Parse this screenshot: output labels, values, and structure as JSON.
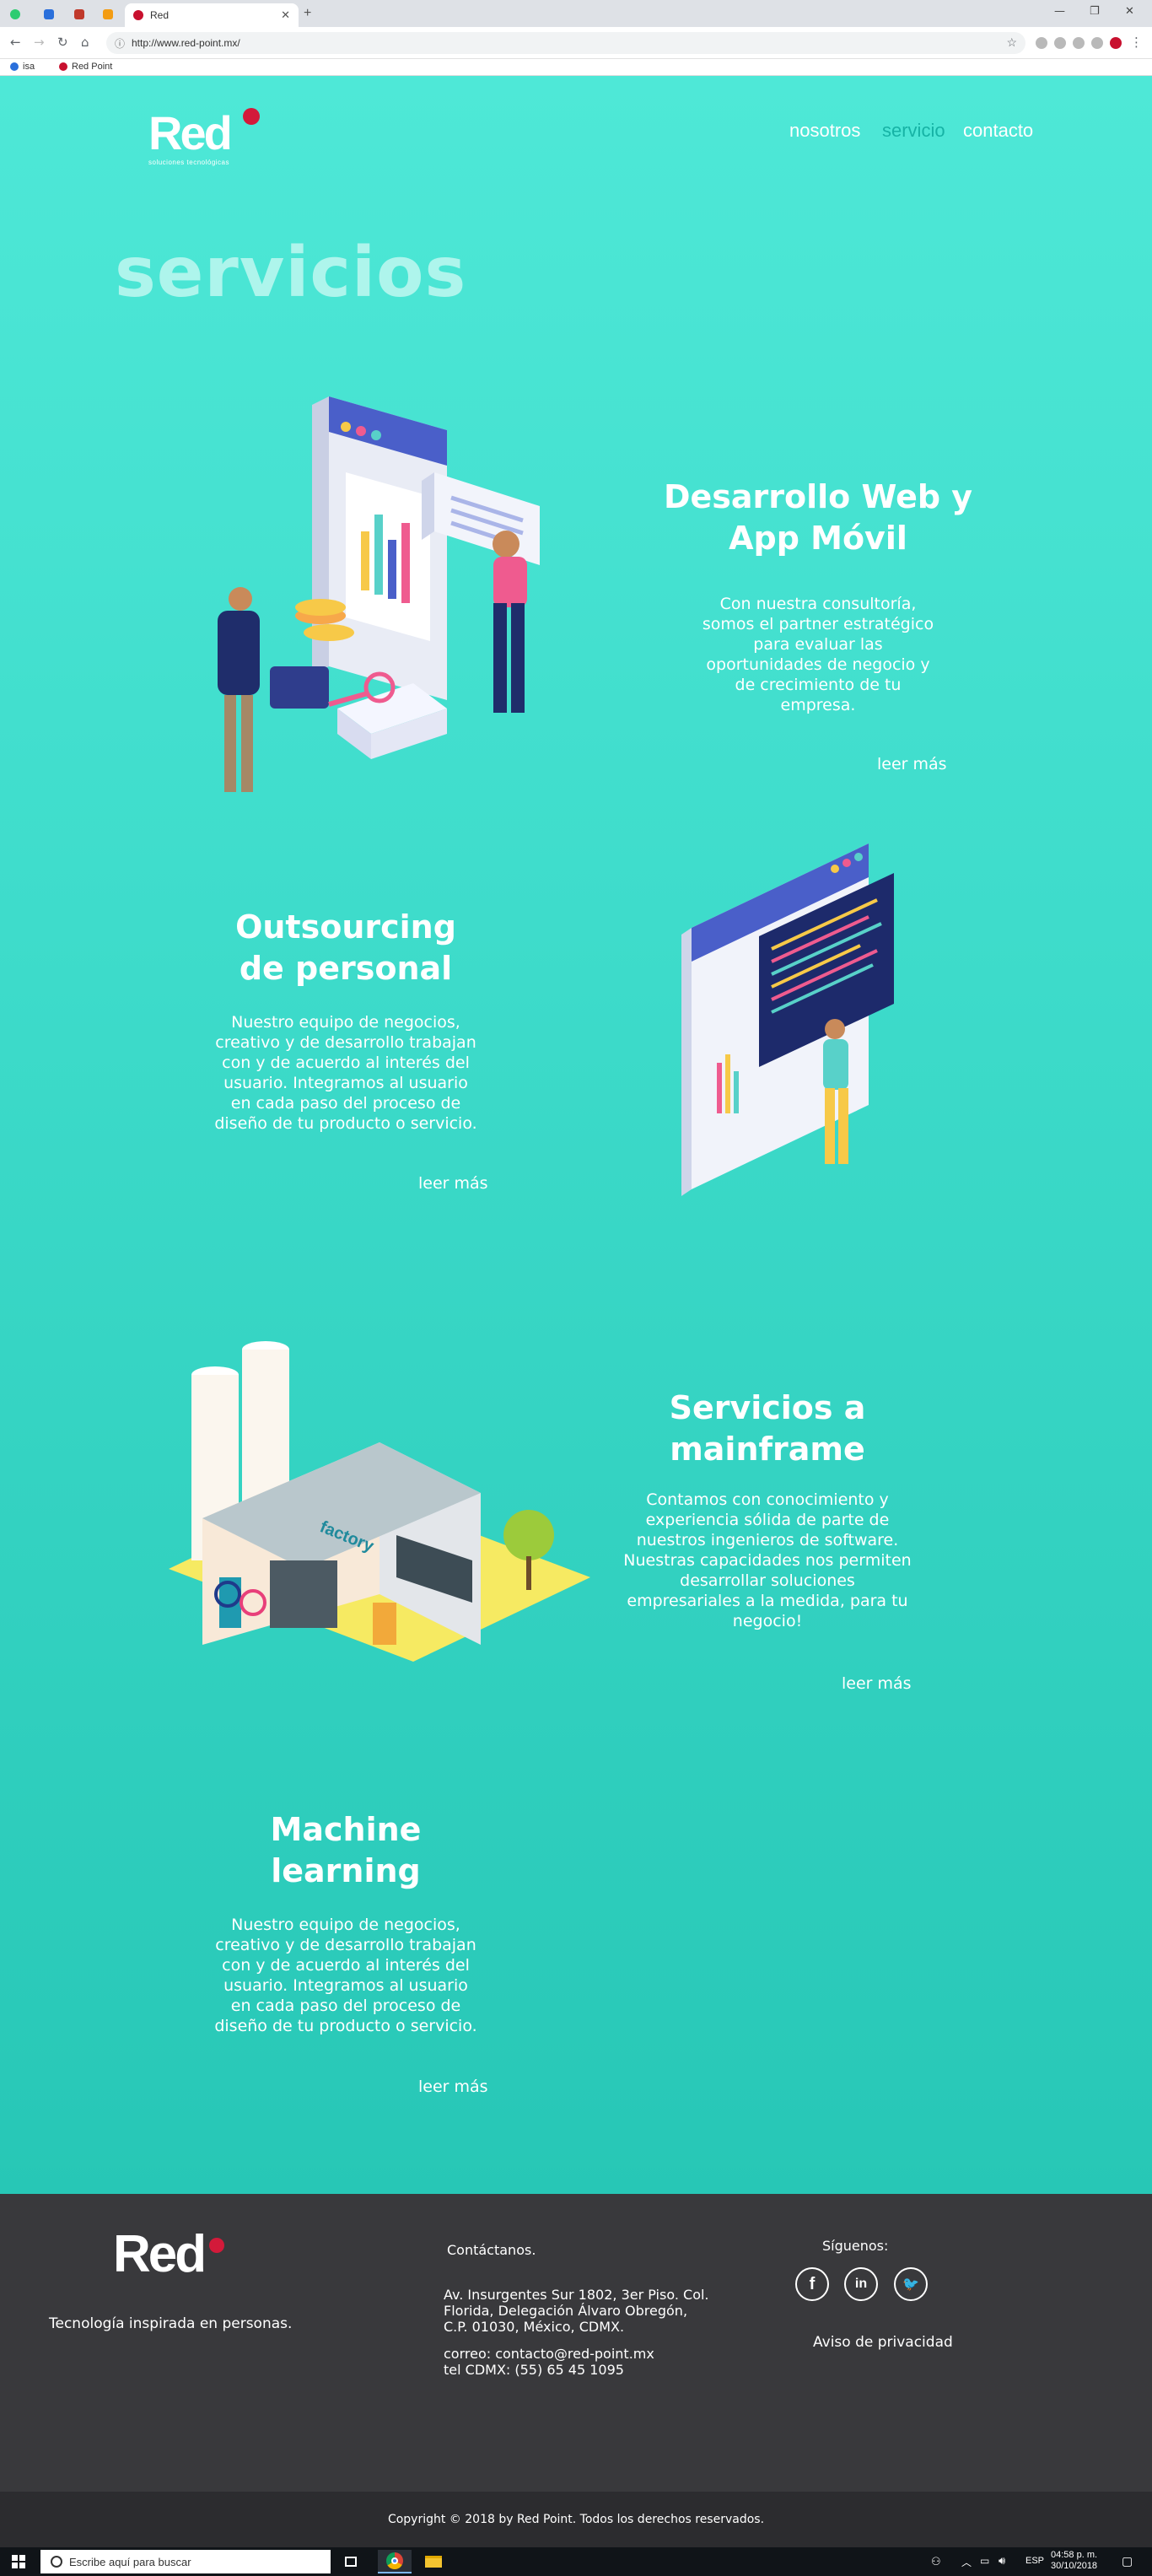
{
  "browser": {
    "tab_title": "Red",
    "new_tab_label": "+",
    "url": "http://www.red-point.mx/",
    "bookmarks": [
      {
        "label": "isa",
        "color": "#2a6fdb"
      },
      {
        "label": "Red Point",
        "color": "#c8102e"
      }
    ]
  },
  "header": {
    "logo_word": "Red",
    "logo_tagline": "soluciones tecnológicas",
    "nav": [
      {
        "label": "nosotros",
        "active": false
      },
      {
        "label": "servicio",
        "active": true
      },
      {
        "label": "contacto",
        "active": false
      }
    ]
  },
  "page_title": "servicios",
  "services": [
    {
      "title_line1": "Desarrollo Web y",
      "title_line2": "App Móvil",
      "description": [
        "Con nuestra consultoría,",
        "somos el partner estratégico",
        "para evaluar las",
        "oportunidades de negocio y",
        "de crecimiento de tu",
        "empresa."
      ],
      "more": "leer más"
    },
    {
      "title_line1": "Outsourcing",
      "title_line2": "de personal",
      "description": [
        "Nuestro equipo de negocios,",
        "creativo y de desarrollo trabajan",
        "con y de acuerdo al interés del",
        "usuario. Integramos al usuario",
        "en cada paso del proceso de",
        "diseño de tu producto o servicio."
      ],
      "more": "leer más"
    },
    {
      "title_line1": "Servicios a",
      "title_line2": "mainframe",
      "description": [
        "Contamos con conocimiento y",
        "experiencia sólida de parte de",
        "nuestros ingenieros de software.",
        "Nuestras capacidades nos permiten",
        "desarrollar soluciones",
        "empresariales a la medida, para tu",
        "negocio!"
      ],
      "more": "leer más"
    },
    {
      "title_line1": "Machine",
      "title_line2": "learning",
      "description": [
        "Nuestro equipo de negocios,",
        "creativo y de desarrollo trabajan",
        "con y de acuerdo al interés del",
        "usuario. Integramos al usuario",
        "en cada paso del proceso de",
        "diseño de tu producto o servicio."
      ],
      "more": "leer más"
    }
  ],
  "illustrations": {
    "factory_sign": "factory"
  },
  "footer": {
    "logo_word": "Red",
    "tagline": "Tecnología inspirada en personas.",
    "contact_heading": "Contáctanos.",
    "address": [
      "Av. Insurgentes Sur 1802, 3er Piso. Col.",
      "Florida, Delegación Álvaro Obregón,",
      "C.P. 01030, México, CDMX."
    ],
    "email": "correo: contacto@red-point.mx",
    "phone": "tel CDMX: (55) 65 45 1095",
    "follow_heading": "Síguenos:",
    "social": [
      {
        "icon": "facebook-icon",
        "glyph": "f"
      },
      {
        "icon": "linkedin-icon",
        "glyph": "in"
      },
      {
        "icon": "twitter-icon",
        "glyph": "🐦"
      }
    ],
    "privacy": "Aviso de privacidad",
    "copyright": "Copyright © 2018 by Red Point. Todos los derechos reservados."
  },
  "taskbar": {
    "search_placeholder": "Escribe aquí para buscar",
    "language": "ESP",
    "time": "04:58 p. m.",
    "date": "30/10/2018"
  },
  "colors": {
    "brand_red": "#d31a3a",
    "page_teal": "#3edccb",
    "active_nav": "#16b3a5",
    "footer_bg": "#39393c"
  }
}
